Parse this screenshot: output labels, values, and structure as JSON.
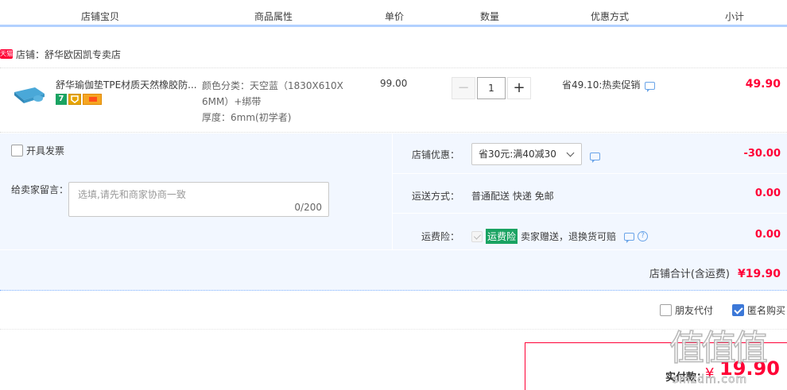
{
  "table_header": {
    "columns": [
      "店铺宝贝",
      "商品属性",
      "单价",
      "数量",
      "优惠方式",
      "小计"
    ]
  },
  "shop": {
    "badge": "天猫",
    "label": "店铺：舒华欧因凯专卖店"
  },
  "item": {
    "title": "舒华瑜伽垫TPE材质天然橡胶防...",
    "badge_1": "7",
    "attrs": {
      "color": "颜色分类：天空蓝（1830X610X",
      "color2": "6MM）+绑带",
      "thickness": "厚度：6mm(初学者)"
    },
    "unit_price": "99.00",
    "quantity": "1",
    "minus_label": "−",
    "plus_label": "+",
    "promo": "省49.10:热卖促销",
    "subtotal": "49.90"
  },
  "options": {
    "invoice_label": "开具发票",
    "message_label": "给卖家留言：",
    "message_placeholder": "选填,请先和商家协商一致",
    "message_count": "0/200",
    "shop_discount_label": "店铺优惠：",
    "shop_discount_select": "省30元:满40减30",
    "shop_discount_value": "-30.00",
    "shipping_label": "运送方式：",
    "shipping_value": "普通配送 快递 免邮",
    "shipping_fee": "0.00",
    "insurance_label": "运费险：",
    "insurance_tag": "运费险",
    "insurance_desc": "卖家赠送，退换货可赔",
    "insurance_fee": "0.00",
    "help_glyph": "?",
    "shop_total_label": "店铺合计(含运费)",
    "shop_total_value": "¥19.90"
  },
  "pay_options": {
    "friend_pay": "朋友代付",
    "anonymous": "匿名购买"
  },
  "total": {
    "label": "实付款：",
    "currency": "¥",
    "value": "19.90"
  },
  "watermark": {
    "logo": "值值值",
    "site": "smzdm.com"
  },
  "colors": {
    "accent": "#ff0036",
    "header_line": "#b2d1ff",
    "panel_bg": "#f2f7ff",
    "checkbox_on": "#3c78d8",
    "insurance_tag": "#1aa362"
  }
}
